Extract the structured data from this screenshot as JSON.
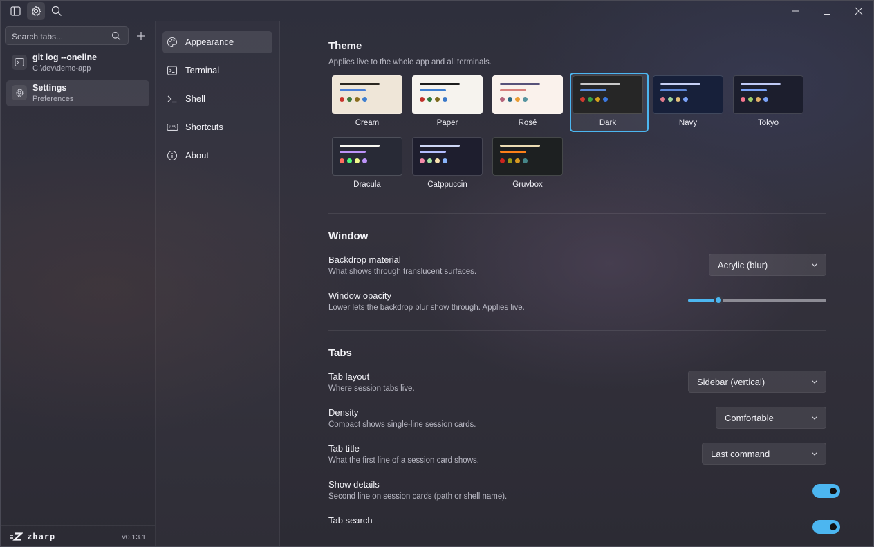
{
  "titlebar": {
    "icons": [
      "sidebar-toggle-icon",
      "gear-icon",
      "search-icon"
    ],
    "controls": [
      "minimize-icon",
      "maximize-icon",
      "close-icon"
    ]
  },
  "sidebar": {
    "search_placeholder": "Search tabs...",
    "sessions": [
      {
        "title": "git log --oneline",
        "subtitle": "C:\\dev\\demo-app",
        "icon": "terminal-icon",
        "active": false
      },
      {
        "title": "Settings",
        "subtitle": "Preferences",
        "icon": "gear-icon",
        "active": true
      }
    ],
    "brand": "zharp",
    "version": "v0.13.1"
  },
  "settings_nav": [
    {
      "label": "Appearance",
      "icon": "palette-icon",
      "active": true
    },
    {
      "label": "Terminal",
      "icon": "terminal-icon",
      "active": false
    },
    {
      "label": "Shell",
      "icon": "prompt-icon",
      "active": false
    },
    {
      "label": "Shortcuts",
      "icon": "keyboard-icon",
      "active": false
    },
    {
      "label": "About",
      "icon": "info-icon",
      "active": false
    }
  ],
  "theme": {
    "title": "Theme",
    "desc": "Applies live to the whole app and all terminals.",
    "selected": "Dark",
    "themes": [
      {
        "name": "Cream",
        "bg": "#efe6d8",
        "bar1": "#2a2620",
        "bar2": "#4a7fd6",
        "dots": [
          "#c8342c",
          "#3d7a3a",
          "#8a6d1e",
          "#3f7fd0"
        ]
      },
      {
        "name": "Paper",
        "bg": "#f6f3ee",
        "bar1": "#1c1c1c",
        "bar2": "#3f7fd0",
        "dots": [
          "#c0302a",
          "#2f7a3a",
          "#7d6a1e",
          "#3a78c8"
        ]
      },
      {
        "name": "Rosé",
        "bg": "#faf2ec",
        "bar1": "#575279",
        "bar2": "#d7827e",
        "dots": [
          "#b4637a",
          "#286983",
          "#ea9d34",
          "#56949f"
        ]
      },
      {
        "name": "Dark",
        "bg": "#262626",
        "bar1": "#c9c9c9",
        "bar2": "#5b8ad8",
        "dots": [
          "#d03a2e",
          "#3aa345",
          "#d7a21d",
          "#3b78e0"
        ]
      },
      {
        "name": "Navy",
        "bg": "#17203a",
        "bar1": "#c6d0f5",
        "bar2": "#5d86d6",
        "dots": [
          "#e07a8a",
          "#9ed49a",
          "#e3c17a",
          "#7aa2f7"
        ]
      },
      {
        "name": "Tokyo",
        "bg": "#1c1e2d",
        "bar1": "#c0caf5",
        "bar2": "#7aa2f7",
        "dots": [
          "#f7768e",
          "#9ece6a",
          "#e0af68",
          "#7aa2f7"
        ]
      },
      {
        "name": "Dracula",
        "bg": "#282a36",
        "bar1": "#f8f8f2",
        "bar2": "#bd93f9",
        "dots": [
          "#ff6e5e",
          "#50fa7b",
          "#f1fa8c",
          "#bd93f9"
        ]
      },
      {
        "name": "Catppuccin",
        "bg": "#1e1e2e",
        "bar1": "#cdd6f4",
        "bar2": "#b4befe",
        "dots": [
          "#f38ba8",
          "#a6e3a1",
          "#f9e2af",
          "#89b4fa"
        ]
      },
      {
        "name": "Gruvbox",
        "bg": "#1d2021",
        "bar1": "#ebdbb2",
        "bar2": "#fe8019",
        "dots": [
          "#cc241d",
          "#98971a",
          "#d79921",
          "#458588"
        ]
      }
    ]
  },
  "window_section": {
    "title": "Window",
    "backdrop": {
      "label": "Backdrop material",
      "desc": "What shows through translucent surfaces.",
      "value": "Acrylic (blur)"
    },
    "opacity": {
      "label": "Window opacity",
      "desc": "Lower lets the backdrop blur show through. Applies live.",
      "value_fraction": 0.22
    }
  },
  "tabs_section": {
    "title": "Tabs",
    "layout": {
      "label": "Tab layout",
      "desc": "Where session tabs live.",
      "value": "Sidebar (vertical)"
    },
    "density": {
      "label": "Density",
      "desc": "Compact shows single-line session cards.",
      "value": "Comfortable"
    },
    "tab_title": {
      "label": "Tab title",
      "desc": "What the first line of a session card shows.",
      "value": "Last command"
    },
    "show_details": {
      "label": "Show details",
      "desc": "Second line on session cards (path or shell name).",
      "on": true
    },
    "tab_search": {
      "label": "Tab search",
      "on": true
    }
  },
  "colors": {
    "accent": "#4cb6f0"
  }
}
